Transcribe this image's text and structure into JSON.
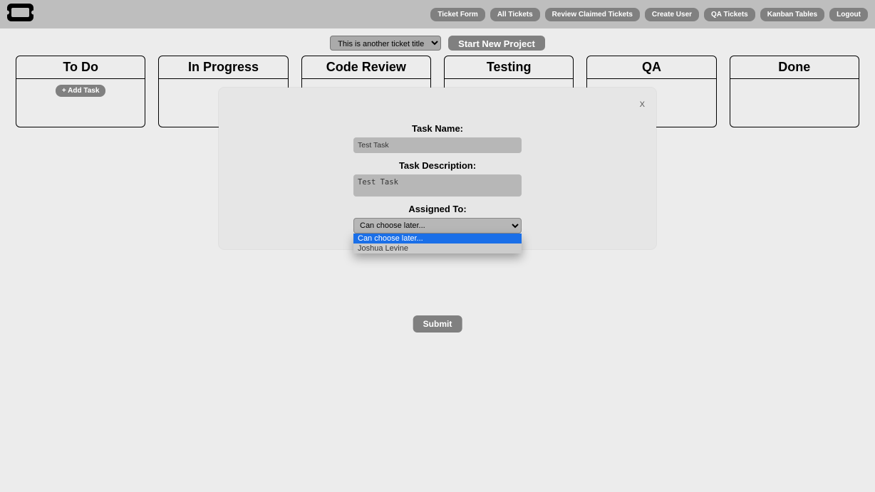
{
  "nav": {
    "items": [
      "Ticket Form",
      "All Tickets",
      "Review Claimed Tickets",
      "Create User",
      "QA Tickets",
      "Kanban Tables",
      "Logout"
    ]
  },
  "toolbar": {
    "project_selected": "This is another ticket title",
    "start_label": "Start New Project"
  },
  "columns": [
    {
      "title": "To Do",
      "add_label": "+ Add Task",
      "show_add": true
    },
    {
      "title": "In Progress",
      "show_add": false
    },
    {
      "title": "Code Review",
      "show_add": false
    },
    {
      "title": "Testing",
      "show_add": false
    },
    {
      "title": "QA",
      "show_add": false
    },
    {
      "title": "Done",
      "show_add": false
    }
  ],
  "modal": {
    "close": "X",
    "task_name_label": "Task Name:",
    "task_name_value": "Test Task",
    "task_desc_label": "Task Description:",
    "task_desc_value": "Test Task",
    "assigned_label": "Assigned To:",
    "assigned_selected": "Can choose later...",
    "submit_label": "Submit",
    "dropdown": {
      "options": [
        {
          "label": "Can choose later...",
          "highlighted": true
        },
        {
          "label": "Joshua Levine",
          "highlighted": false
        }
      ]
    }
  }
}
